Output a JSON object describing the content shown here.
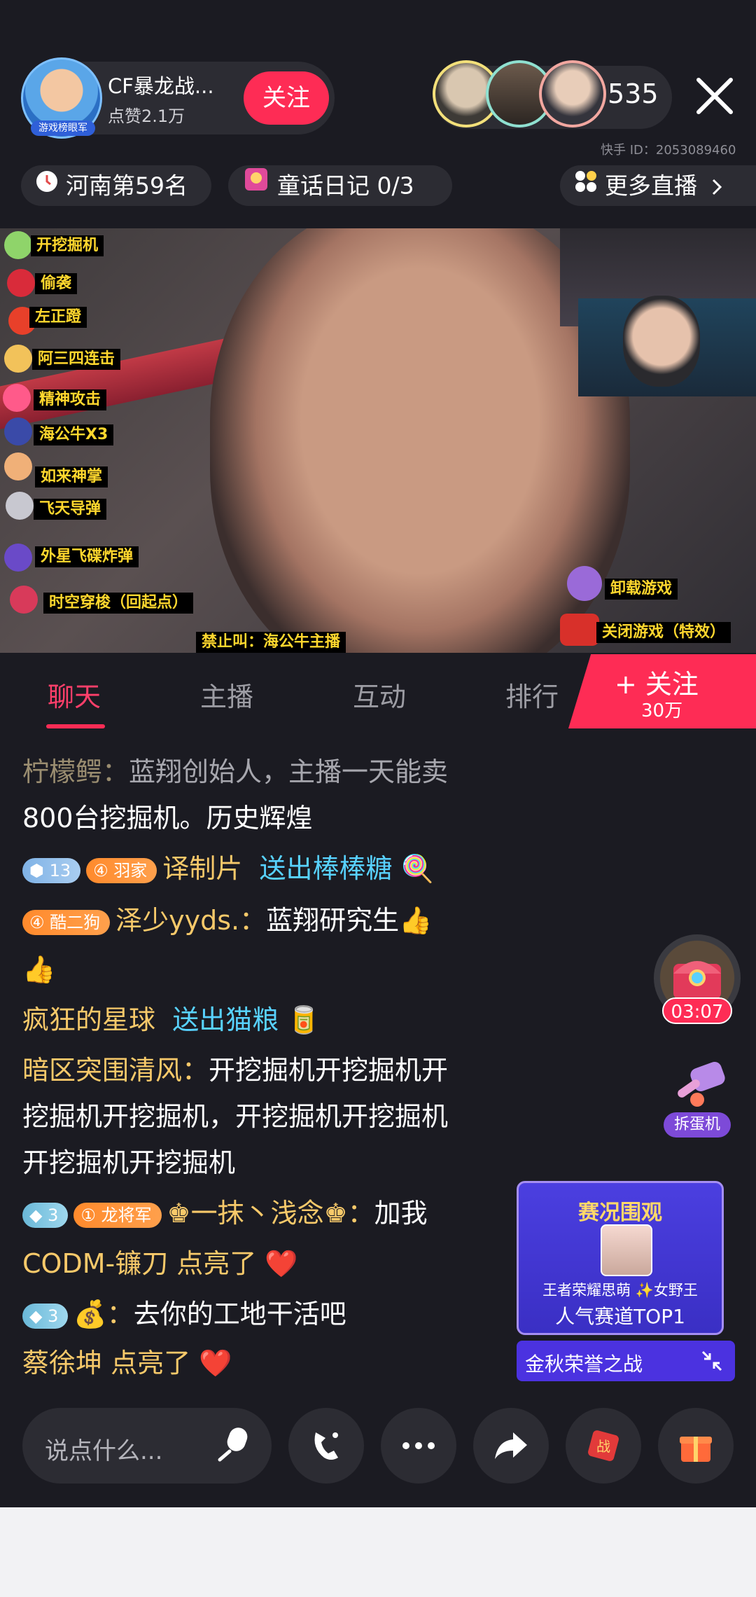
{
  "host": {
    "name": "CF暴龙战...",
    "likes": "点赞2.1万",
    "avatar_tag": "游戏榜眼军",
    "follow_label": "关注"
  },
  "viewers": {
    "count": "535"
  },
  "kuaishou_id": "快手 ID：2053089460",
  "tags": {
    "rank": "河南第59名",
    "diary": "童话日记 0/3",
    "more": "更多直播"
  },
  "video": {
    "effects_left": [
      "开挖掘机",
      "偷袭",
      "左正蹬",
      "阿三四连击",
      "精神攻击",
      "海公牛X3",
      "如来神掌",
      "飞天导弹",
      "外星飞碟炸弹",
      "时空穿梭（回起点）"
    ],
    "effect_bottom": "禁止叫：海公牛主播",
    "effects_right": [
      "卸载游戏",
      "关闭游戏（特效）"
    ]
  },
  "tabs": {
    "chat": "聊天",
    "anchor": "主播",
    "interact": "互动",
    "rank": "排行",
    "follow_label": "+ 关注",
    "follow_count": "30万"
  },
  "chat": {
    "m1_user": "柠檬鳄：",
    "m1_text1": "蓝翔创始人，主播一天能卖",
    "m1_text2": "800台挖掘机。历史辉煌",
    "m2_level": "13",
    "m2_fan": "羽家",
    "m2_user": "译制片",
    "m2_gift": "送出棒棒糖",
    "m3_fan": "酷二狗",
    "m3_user": "泽少yyds.：",
    "m3_text": "蓝翔研究生👍",
    "m3_text2": "👍",
    "m4_user": "疯狂的星球",
    "m4_gift": "送出猫粮",
    "m5_user": "暗区突围清风：",
    "m5_text1": "开挖掘机开挖掘机开",
    "m5_text2": "挖掘机开挖掘机，开挖掘机开挖掘机",
    "m5_text3": "开挖掘机开挖掘机",
    "m6_level": "3",
    "m6_fan": "龙将军",
    "m6_user": "♚一抹丶浅念♚：",
    "m6_text": "加我",
    "m7_text": "CODM-镰刀 点亮了 ❤️",
    "m8_level": "3",
    "m8_user": "💰：",
    "m8_text": "去你的工地干活吧",
    "m9_text": "蔡徐坤 点亮了 ❤️"
  },
  "widgets": {
    "treasure_time": "03:07",
    "hammer_label": "拆蛋机",
    "banner_title": "赛况围观",
    "banner_line1": "王者荣耀思萌 ✨女野王",
    "banner_line2": "人气赛道TOP1",
    "banner_footer": "金秋荣誉之战"
  },
  "bottom": {
    "input_placeholder": "说点什么..."
  },
  "colors": {
    "accent": "#fe2c55",
    "bg": "#1b1b22",
    "username": "#f7c96a",
    "gift": "#58d2ff"
  }
}
